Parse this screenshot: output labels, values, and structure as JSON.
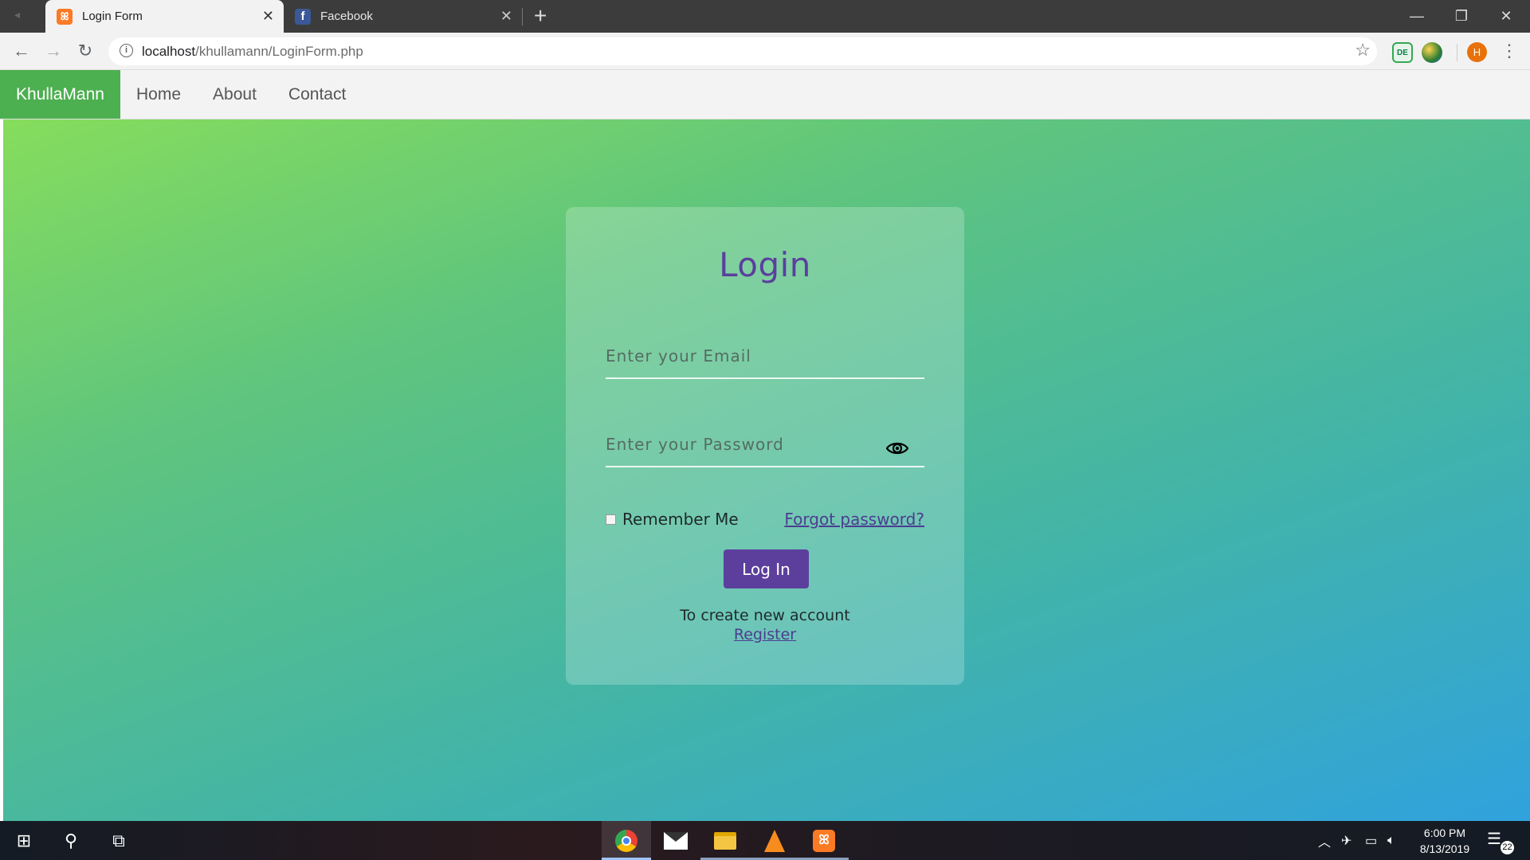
{
  "browser": {
    "tabs": [
      {
        "title": "Login Form",
        "icon": "xampp-icon",
        "active": true
      },
      {
        "title": "Facebook",
        "icon": "facebook-icon",
        "active": false
      }
    ],
    "url_host": "localhost",
    "url_path": "/khullamann/LoginForm.php",
    "profile_initial": "H",
    "extension_badge": "DE"
  },
  "navbar": {
    "brand": "KhullaMann",
    "links": [
      "Home",
      "About",
      "Contact"
    ],
    "brand_color": "#4caf50"
  },
  "login": {
    "heading": "Login",
    "email_placeholder": "Enter your Email",
    "password_placeholder": "Enter your Password",
    "remember_label": "Remember Me",
    "forgot_label": "Forgot password?",
    "submit_label": "Log In",
    "create_text": "To create new account",
    "register_label": "Register",
    "accent_color": "#5c3f9d"
  },
  "taskbar": {
    "apps": [
      "chrome-icon",
      "mail-icon",
      "file-explorer-icon",
      "vlc-icon",
      "xampp-icon"
    ],
    "time": "6:00 PM",
    "date": "8/13/2019",
    "notification_count": "22"
  }
}
